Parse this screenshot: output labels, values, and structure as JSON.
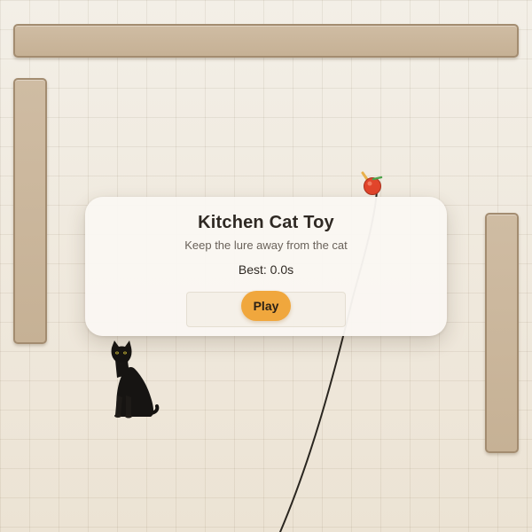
{
  "game": {
    "title": "Kitchen Cat Toy",
    "subtitle": "Keep the lure away from the cat",
    "best_label": "Best: 0.0s",
    "play_label": "Play"
  },
  "scene": {
    "icons": [
      "cat-icon",
      "lure-ball-icon",
      "wand-stick-icon"
    ],
    "colors": {
      "floor": "#f1ebe1",
      "counter": "#c9b59a",
      "counter_border": "#a38c70",
      "card": "#faf7f2",
      "accent_button": "#f0a73d",
      "lure_ball": "#e2452b",
      "string": "#2a2620"
    }
  }
}
